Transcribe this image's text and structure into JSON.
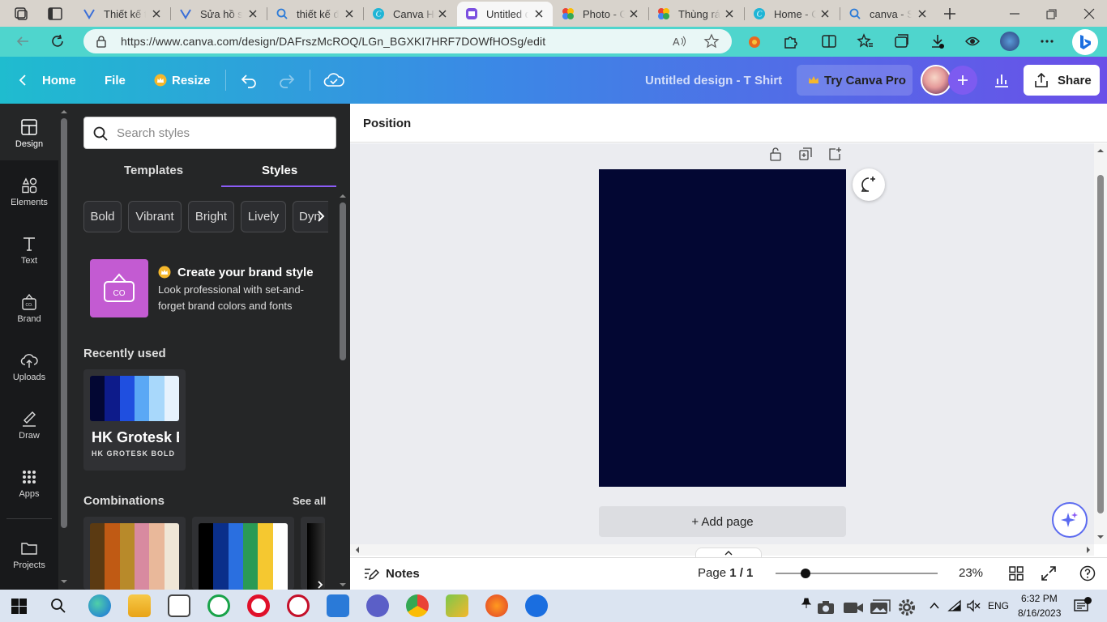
{
  "browser": {
    "tabs": [
      {
        "label": "Thiết kế tì",
        "icon": "generic-page-icon",
        "active": false
      },
      {
        "label": "Sửa hồ sơ",
        "icon": "generic-page-icon",
        "active": false
      },
      {
        "label": "thiết kế đi",
        "icon": "search-icon",
        "active": false
      },
      {
        "label": "Canva He",
        "icon": "canva-icon",
        "active": false
      },
      {
        "label": "Untitled d",
        "icon": "canva-doc-icon",
        "active": true
      },
      {
        "label": "Photo - G",
        "icon": "google-photos-icon",
        "active": false
      },
      {
        "label": "Thùng rác",
        "icon": "google-photos-icon",
        "active": false
      },
      {
        "label": "Home - C",
        "icon": "canva-icon",
        "active": false
      },
      {
        "label": "canva - Se",
        "icon": "search-icon",
        "active": false
      }
    ],
    "url": "https://www.canva.com/design/DAFrszMcROQ/LGn_BGXKI7HRF7DOWfHOSg/edit"
  },
  "header": {
    "home": "Home",
    "file": "File",
    "resize": "Resize",
    "design_title": "Untitled design - T Shirt",
    "try_pro": "Try Canva Pro",
    "share": "Share"
  },
  "rail": [
    {
      "label": "Design",
      "icon": "design-layout-icon"
    },
    {
      "label": "Elements",
      "icon": "elements-shapes-icon"
    },
    {
      "label": "Text",
      "icon": "text-t-icon"
    },
    {
      "label": "Brand",
      "icon": "brand-kit-icon"
    },
    {
      "label": "Uploads",
      "icon": "upload-cloud-icon"
    },
    {
      "label": "Draw",
      "icon": "draw-pen-icon"
    },
    {
      "label": "Apps",
      "icon": "apps-grid-icon"
    },
    {
      "label": "Projects",
      "icon": "folder-icon"
    }
  ],
  "panel": {
    "search_placeholder": "Search styles",
    "tabs": [
      "Templates",
      "Styles"
    ],
    "active_tab": "Styles",
    "chips": [
      "Bold",
      "Vibrant",
      "Bright",
      "Lively",
      "Dyn"
    ],
    "brand_promo": {
      "title": "Create your brand style",
      "desc": "Look professional with set-and-forget brand colors and fonts"
    },
    "recently_used_title": "Recently used",
    "recent_style": {
      "colors": [
        "#030733",
        "#0d1b8a",
        "#1f4fe0",
        "#5aa8f5",
        "#a8d8fb",
        "#e6f2fd"
      ],
      "font_big": "HK Grotesk Bold",
      "font_small": "HK GROTESK BOLD"
    },
    "combinations_title": "Combinations",
    "see_all": "See all",
    "combinations": [
      [
        "#5b3a12",
        "#c05a14",
        "#b88a2a",
        "#d88aa0",
        "#e9b89a",
        "#efe6d6"
      ],
      [
        "#000000",
        "#0a2f8a",
        "#2a6fe0",
        "#2a9a55",
        "#f5c830",
        "#ffffff"
      ]
    ]
  },
  "editor": {
    "toolbar_label": "Position",
    "add_page": "+ Add page",
    "canvas_color": "#030733"
  },
  "footer": {
    "notes": "Notes",
    "page_indicator_prefix": "Page ",
    "page_indicator_value": "1 / 1",
    "zoom": "23%",
    "zoom_fraction": 0.23
  },
  "taskbar": {
    "language": "ENG",
    "time": "6:32 PM",
    "date": "8/16/2023"
  }
}
